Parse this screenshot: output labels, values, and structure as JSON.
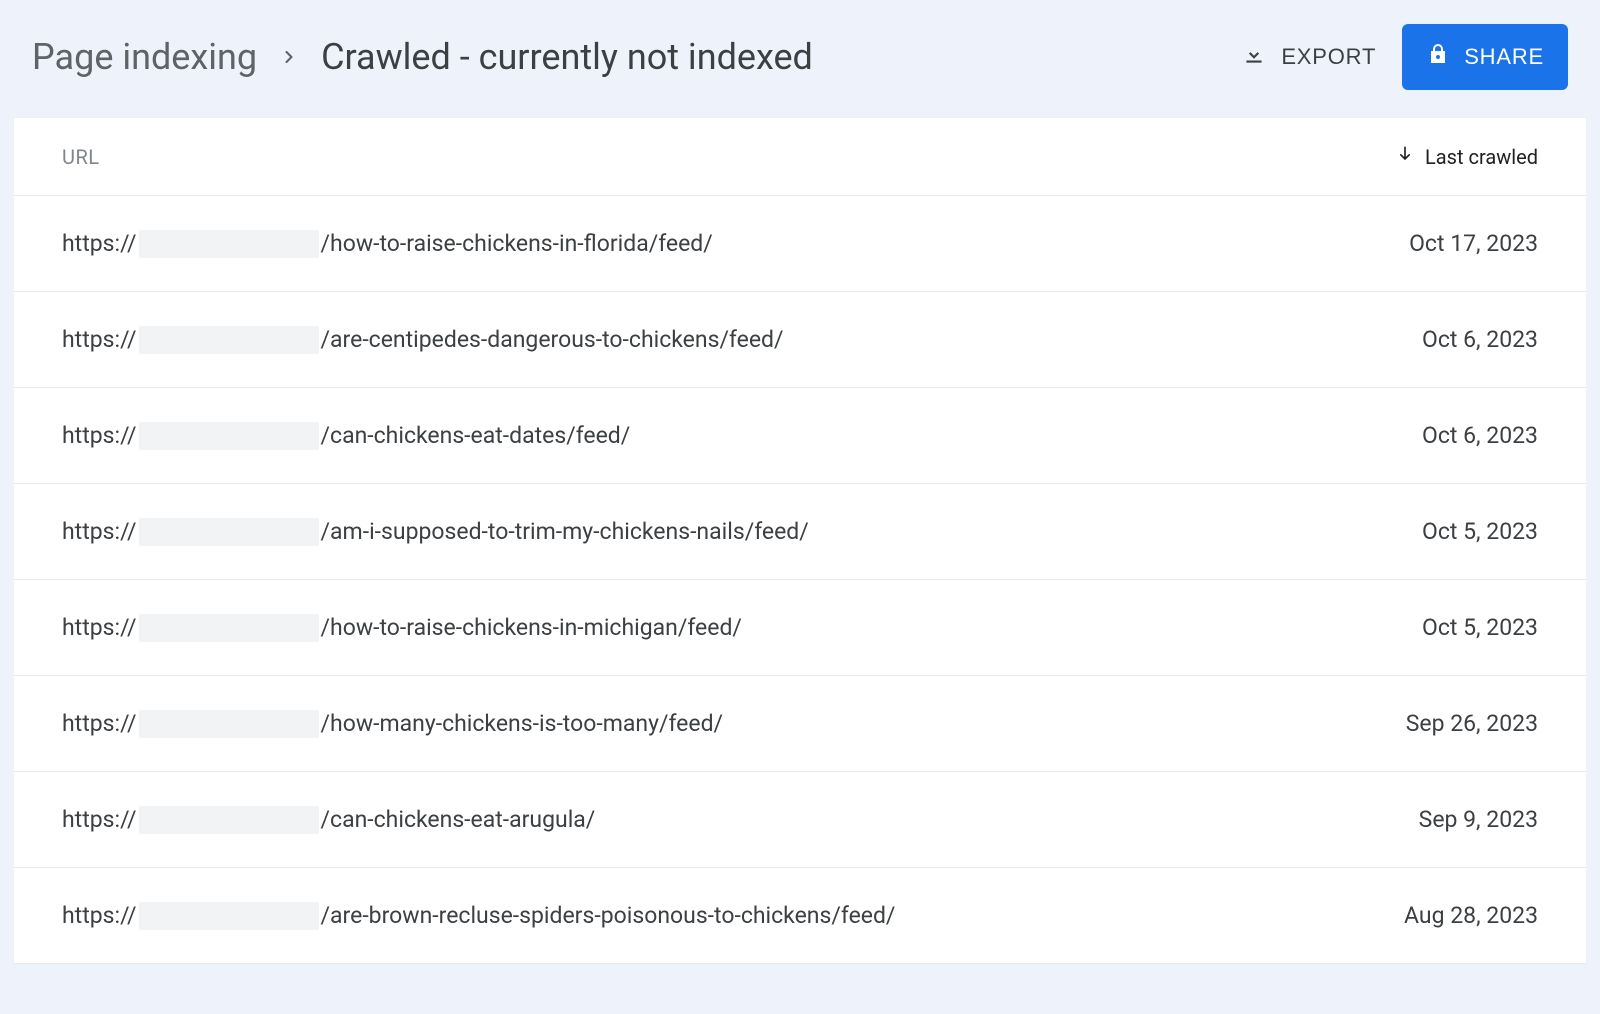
{
  "breadcrumb": {
    "parent": "Page indexing",
    "current": "Crawled - currently not indexed"
  },
  "actions": {
    "export_label": "EXPORT",
    "share_label": "SHARE"
  },
  "table": {
    "headers": {
      "url": "URL",
      "last_crawled": "Last crawled"
    },
    "rows": [
      {
        "url_prefix": "https://",
        "url_path": "/how-to-raise-chickens-in-florida/feed/",
        "date": "Oct 17, 2023"
      },
      {
        "url_prefix": "https://",
        "url_path": "/are-centipedes-dangerous-to-chickens/feed/",
        "date": "Oct 6, 2023"
      },
      {
        "url_prefix": "https://",
        "url_path": "/can-chickens-eat-dates/feed/",
        "date": "Oct 6, 2023"
      },
      {
        "url_prefix": "https://",
        "url_path": "/am-i-supposed-to-trim-my-chickens-nails/feed/",
        "date": "Oct 5, 2023"
      },
      {
        "url_prefix": "https://",
        "url_path": "/how-to-raise-chickens-in-michigan/feed/",
        "date": "Oct 5, 2023"
      },
      {
        "url_prefix": "https://",
        "url_path": "/how-many-chickens-is-too-many/feed/",
        "date": "Sep 26, 2023"
      },
      {
        "url_prefix": "https://",
        "url_path": "/can-chickens-eat-arugula/",
        "date": "Sep 9, 2023"
      },
      {
        "url_prefix": "https://",
        "url_path": "/are-brown-recluse-spiders-poisonous-to-chickens/feed/",
        "date": "Aug 28, 2023"
      }
    ]
  }
}
